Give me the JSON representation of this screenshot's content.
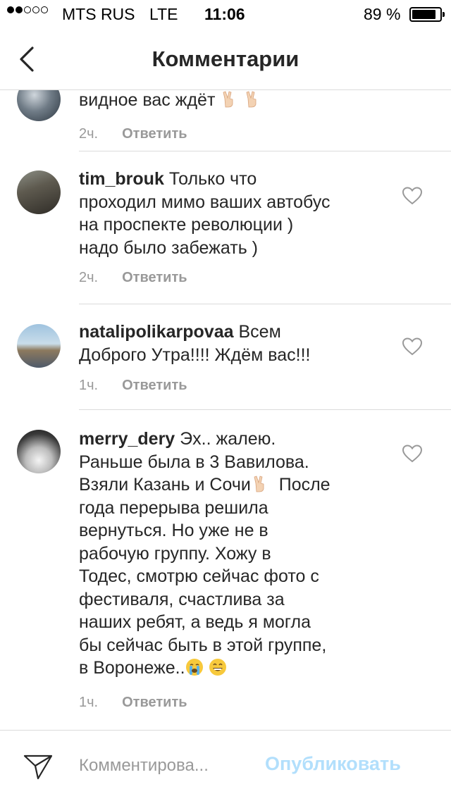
{
  "status_bar": {
    "carrier": "MTS RUS",
    "network": "LTE",
    "time": "11:06",
    "battery": "89 %",
    "signal_bars_filled": 2,
    "signal_bars_total": 5,
    "battery_level": 0.89
  },
  "nav": {
    "title": "Комментарии",
    "back_icon": "chevron-left-icon"
  },
  "comments": [
    {
      "username": "",
      "text_lines": [
        "видное вас ждёт"
      ],
      "emojis_after": [
        "victory-hand",
        "victory-hand"
      ],
      "time": "2ч.",
      "reply_label": "Ответить",
      "partial": true
    },
    {
      "username": "tim_brouk",
      "text_lines": [
        "Только что",
        "проходил мимо ваших автобус",
        "на проспекте революции )",
        "надо было забежать )"
      ],
      "time": "2ч.",
      "reply_label": "Ответить"
    },
    {
      "username": "natalipolikarpovaa",
      "text_lines": [
        "Всем",
        "Доброго Утра!!!! Ждём вас!!!"
      ],
      "time": "1ч.",
      "reply_label": "Ответить"
    },
    {
      "username": "merry_dery",
      "text_lines": [
        "Эх.. жалею.",
        "Раньше была в 3 Вавилова.",
        "Взяли Казань и Сочи",
        "После",
        "года перерыва решила",
        "вернуться. Но уже не в",
        "рабочую группу. Хожу в",
        "Тодес, смотрю сейчас фото с",
        "фестиваля, счастлива за",
        "наших ребят, а ведь я могла",
        "бы сейчас быть в этой группе,",
        "в Воронеже.."
      ],
      "time": "1ч.",
      "reply_label": "Ответить"
    }
  ],
  "composer": {
    "placeholder": "Комментирова...",
    "publish_label": "Опубликовать",
    "publish_color": "#b2dffc"
  },
  "colors": {
    "text": "#262626",
    "muted": "#999999",
    "divider": "#dbdbdb"
  }
}
